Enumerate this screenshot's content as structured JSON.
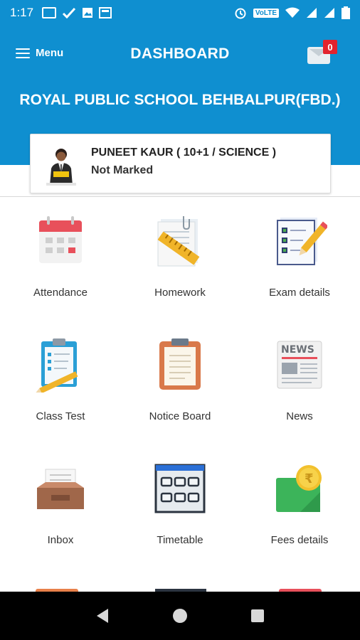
{
  "status_bar": {
    "time": "1:17",
    "network": "VoLTE"
  },
  "header": {
    "menu_label": "Menu",
    "title": "DASHBOARD",
    "mail_badge": "0",
    "school_name": "ROYAL PUBLIC SCHOOL BEHBALPUR(FBD.)"
  },
  "student": {
    "name_line": "PUNEET KAUR   ( 10+1 / SCIENCE )",
    "status": "Not Marked"
  },
  "menu_items": [
    {
      "label": "Attendance",
      "icon": "calendar-icon"
    },
    {
      "label": "Homework",
      "icon": "homework-icon"
    },
    {
      "label": "Exam details",
      "icon": "exam-details-icon"
    },
    {
      "label": "Class Test",
      "icon": "class-test-icon"
    },
    {
      "label": "Notice Board",
      "icon": "notice-board-icon"
    },
    {
      "label": "News",
      "icon": "news-icon"
    },
    {
      "label": "Inbox",
      "icon": "inbox-icon"
    },
    {
      "label": "Timetable",
      "icon": "timetable-icon"
    },
    {
      "label": "Fees details",
      "icon": "fees-icon"
    }
  ],
  "colors": {
    "primary": "#0f8fd0",
    "badge": "#e2232e",
    "nav_bar": "#000000"
  }
}
